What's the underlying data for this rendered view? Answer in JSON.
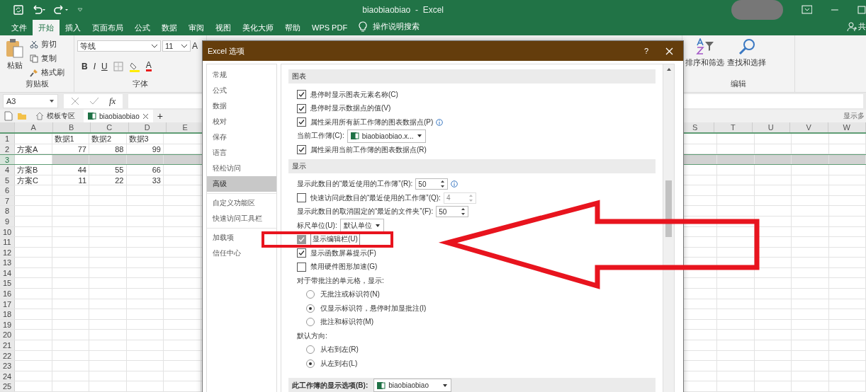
{
  "window": {
    "title": "biaobiaobiao  -  Excel"
  },
  "ribbon_tabs": [
    {
      "label": "文件",
      "selected": false
    },
    {
      "label": "开始",
      "selected": true
    },
    {
      "label": "插入",
      "selected": false
    },
    {
      "label": "页面布局",
      "selected": false
    },
    {
      "label": "公式",
      "selected": false
    },
    {
      "label": "数据",
      "selected": false
    },
    {
      "label": "审阅",
      "selected": false
    },
    {
      "label": "视图",
      "selected": false
    },
    {
      "label": "美化大师",
      "selected": false
    },
    {
      "label": "帮助",
      "selected": false
    },
    {
      "label": "WPS PDF",
      "selected": false
    }
  ],
  "tell_me": "操作说明搜索",
  "share": "共",
  "ribbon": {
    "clipboard": {
      "paste": "粘贴",
      "cut": "剪切",
      "copy": "复制",
      "format_painter": "格式刷",
      "group_label": "剪贴板"
    },
    "font": {
      "font_name": "等线",
      "font_size": "11",
      "grow": "A",
      "bold": "B",
      "italic": "I",
      "underline": "U",
      "font_color": "A",
      "group_label": "字体"
    },
    "editing": {
      "sort_filter": "排序和筛选",
      "find_select": "查找和选择",
      "group_label": "编辑"
    }
  },
  "formula_bar": {
    "name_box": "A3",
    "function_label": "fx"
  },
  "doc_tabs": {
    "template": "模板专区",
    "file": "biaobiaobiao",
    "add": "+",
    "right_hint": "显示多"
  },
  "sheet": {
    "columns": [
      "A",
      "B",
      "C",
      "D",
      "E",
      "S",
      "T",
      "U",
      "V",
      "W"
    ],
    "rows": [
      {
        "label": "1",
        "selected": false,
        "cells": {
          "B": "数据1",
          "C": "数据2",
          "D": "数据3"
        }
      },
      {
        "label": "2",
        "selected": false,
        "cells": {
          "A": "方案A",
          "B": "77",
          "C": "88",
          "D": "99"
        }
      },
      {
        "label": "3",
        "selected": true
      },
      {
        "label": "4",
        "selected": false,
        "cells": {
          "A": "方案B",
          "B": "44",
          "C": "55",
          "D": "66"
        }
      },
      {
        "label": "5",
        "selected": false,
        "cells": {
          "A": "方案C",
          "B": "11",
          "C": "22",
          "D": "33"
        }
      },
      {
        "label": "6",
        "selected": false
      },
      {
        "label": "7",
        "selected": false
      },
      {
        "label": "8",
        "selected": false
      },
      {
        "label": "9",
        "selected": false
      },
      {
        "label": "10",
        "selected": false
      },
      {
        "label": "11",
        "selected": false
      },
      {
        "label": "12",
        "selected": false
      },
      {
        "label": "13",
        "selected": false
      },
      {
        "label": "14",
        "selected": false
      },
      {
        "label": "15",
        "selected": false
      },
      {
        "label": "16",
        "selected": false
      },
      {
        "label": "17",
        "selected": false
      },
      {
        "label": "18",
        "selected": false
      },
      {
        "label": "19",
        "selected": false
      },
      {
        "label": "20",
        "selected": false
      },
      {
        "label": "21",
        "selected": false
      },
      {
        "label": "22",
        "selected": false
      },
      {
        "label": "23",
        "selected": false
      },
      {
        "label": "24",
        "selected": false
      },
      {
        "label": "25",
        "selected": false
      }
    ]
  },
  "dialog": {
    "title": "Excel 选项",
    "help": "?",
    "nav": [
      {
        "items": [
          {
            "label": "常规",
            "selected": false
          },
          {
            "label": "公式",
            "selected": false
          },
          {
            "label": "数据",
            "selected": false
          },
          {
            "label": "校对",
            "selected": false
          },
          {
            "label": "保存",
            "selected": false
          },
          {
            "label": "语言",
            "selected": false
          },
          {
            "label": "轻松访问",
            "selected": false
          },
          {
            "label": "高级",
            "selected": true
          }
        ]
      },
      {
        "items": [
          {
            "label": "自定义功能区",
            "selected": false
          },
          {
            "label": "快速访问工具栏",
            "selected": false
          }
        ]
      },
      {
        "items": [
          {
            "label": "加载项",
            "selected": false
          },
          {
            "label": "信任中心",
            "selected": false
          }
        ]
      }
    ],
    "sections": [
      {
        "title": "图表",
        "items": [
          {
            "kind": "checkbox",
            "label": "悬停时显示图表元素名称(C)",
            "checked": true,
            "focused": false
          },
          {
            "kind": "checkbox",
            "label": "悬停时显示数据点的值(V)",
            "checked": true,
            "focused": false
          },
          {
            "kind": "checkbox",
            "label": "属性采用所有新工作簿的图表数据点(P)",
            "checked": true,
            "focused": false,
            "info": true
          },
          {
            "kind": "dropdown",
            "label": "当前工作簿(C):",
            "value": "biaobiaobiao.x...",
            "file_icon": true
          },
          {
            "kind": "checkbox",
            "label": "属性采用当前工作簿的图表数据点(R)",
            "checked": true,
            "focused": false
          }
        ]
      },
      {
        "title": "显示",
        "items": [
          {
            "kind": "spin",
            "label": "显示此数目的“最近使用的工作簿”(R):",
            "value": "50",
            "disabled": false,
            "info": true
          },
          {
            "kind": "checkbox_spin",
            "label": "快速访问此数目的“最近使用的工作簿”(Q):",
            "checked": false,
            "value": "4",
            "disabled": true
          },
          {
            "kind": "spin",
            "label": "显示此数目的取消固定的“最近的文件夹”(F):",
            "value": "50",
            "disabled": false
          },
          {
            "kind": "dropdown",
            "label": "标尺单位(U):",
            "value": "默认单位"
          },
          {
            "kind": "checkbox",
            "label": "显示编辑栏(U)",
            "checked": true,
            "focused": true,
            "annotated": true
          },
          {
            "kind": "checkbox",
            "label": "显示函数屏幕提示(F)",
            "checked": true,
            "focused": false
          },
          {
            "kind": "checkbox",
            "label": "禁用硬件图形加速(G)",
            "checked": false,
            "focused": false
          },
          {
            "kind": "label",
            "label": "对于带批注的单元格，显示:"
          },
          {
            "kind": "radio",
            "label": "无批注或标识符(N)",
            "selected": false
          },
          {
            "kind": "radio",
            "label": "仅显示标识符，悬停时加显批注(I)",
            "selected": true
          },
          {
            "kind": "radio",
            "label": "批注和标识符(M)",
            "selected": false
          },
          {
            "kind": "label",
            "label": "默认方向:"
          },
          {
            "kind": "radio",
            "label": "从右到左(R)",
            "selected": false
          },
          {
            "kind": "radio",
            "label": "从左到右(L)",
            "selected": true
          }
        ]
      }
    ],
    "workbook_display": {
      "label": "此工作簿的显示选项(B):",
      "value": "biaobiaobiao"
    }
  }
}
